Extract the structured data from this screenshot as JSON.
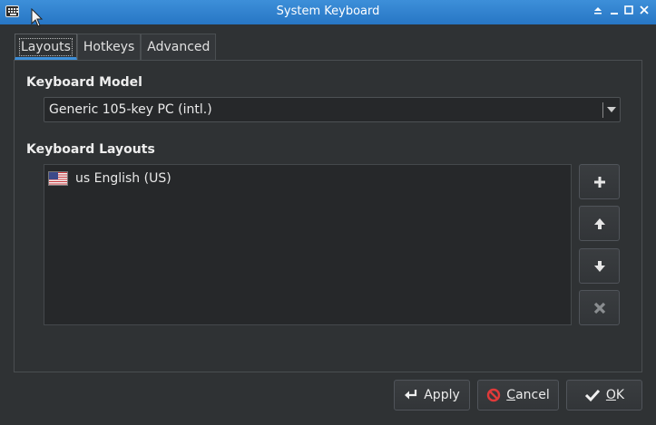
{
  "window": {
    "title": "System Keyboard",
    "icon": "keyboard-icon",
    "accent": "#3d8fd9"
  },
  "tabs": [
    {
      "label": "Layouts",
      "active": true
    },
    {
      "label": "Hotkeys",
      "active": false
    },
    {
      "label": "Advanced",
      "active": false
    }
  ],
  "model": {
    "label": "Keyboard Model",
    "value": "Generic 105-key PC (intl.)"
  },
  "layouts": {
    "label": "Keyboard Layouts",
    "items": [
      {
        "code": "us",
        "name": "English (US)",
        "flag": "us-flag-icon"
      }
    ],
    "buttons": [
      "add-icon",
      "move-up-icon",
      "move-down-icon",
      "remove-icon"
    ]
  },
  "actions": {
    "apply": "Apply",
    "cancel_prefix": "",
    "cancel_mnemonic": "C",
    "cancel_rest": "ancel",
    "ok_mnemonic": "O",
    "ok_rest": "K"
  }
}
